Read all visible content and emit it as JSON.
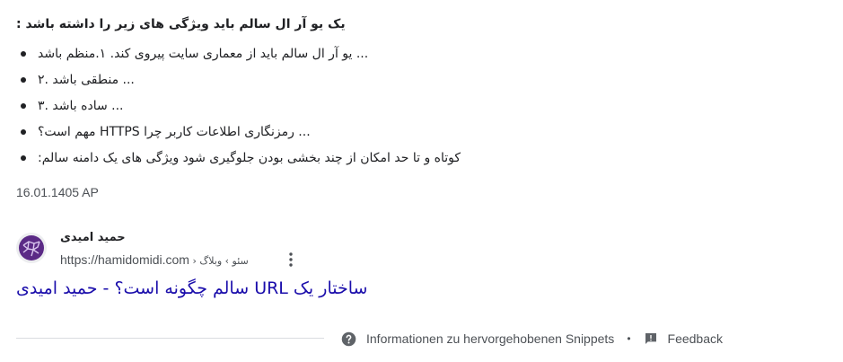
{
  "snippet": {
    "heading": "یک یو آر ال سالم باید ویژگی های زیر را داشته باشد :",
    "items": [
      "... یو آر ال سالم باید از معماری سایت پیروی کند. ۱.منظم باشد",
      "... منطقی باشد .۲",
      "... ساده باشد .۳",
      "... رمزنگاری اطلاعات کاربر چرا HTTPS مهم است؟",
      "کوتاه و تا حد امکان از چند بخشی بودن جلوگیری شود ویژگی های یک دامنه سالم:"
    ],
    "date": "16.01.1405 AP"
  },
  "source": {
    "site_name": "حمید امیدی",
    "url": "https://hamidomidi.com",
    "breadcrumb": " › سئو › وبلاگ",
    "favicon_icon": "purple-network-logo-icon",
    "more_icon": "three-dot-menu-icon"
  },
  "result": {
    "title": "ساختار یک URL سالم چگونه است؟ - حمید امیدی"
  },
  "footer": {
    "about_label": "Informationen zu hervorgehobenen Snippets",
    "separator": "•",
    "feedback_label": "Feedback",
    "help_icon": "question-circle-icon",
    "feedback_icon": "feedback-flag-icon"
  },
  "colors": {
    "link": "#1a0dab",
    "text": "#202124",
    "secondary": "#4d5156",
    "divider": "#dadce0",
    "favicon": "#5b2a86"
  }
}
